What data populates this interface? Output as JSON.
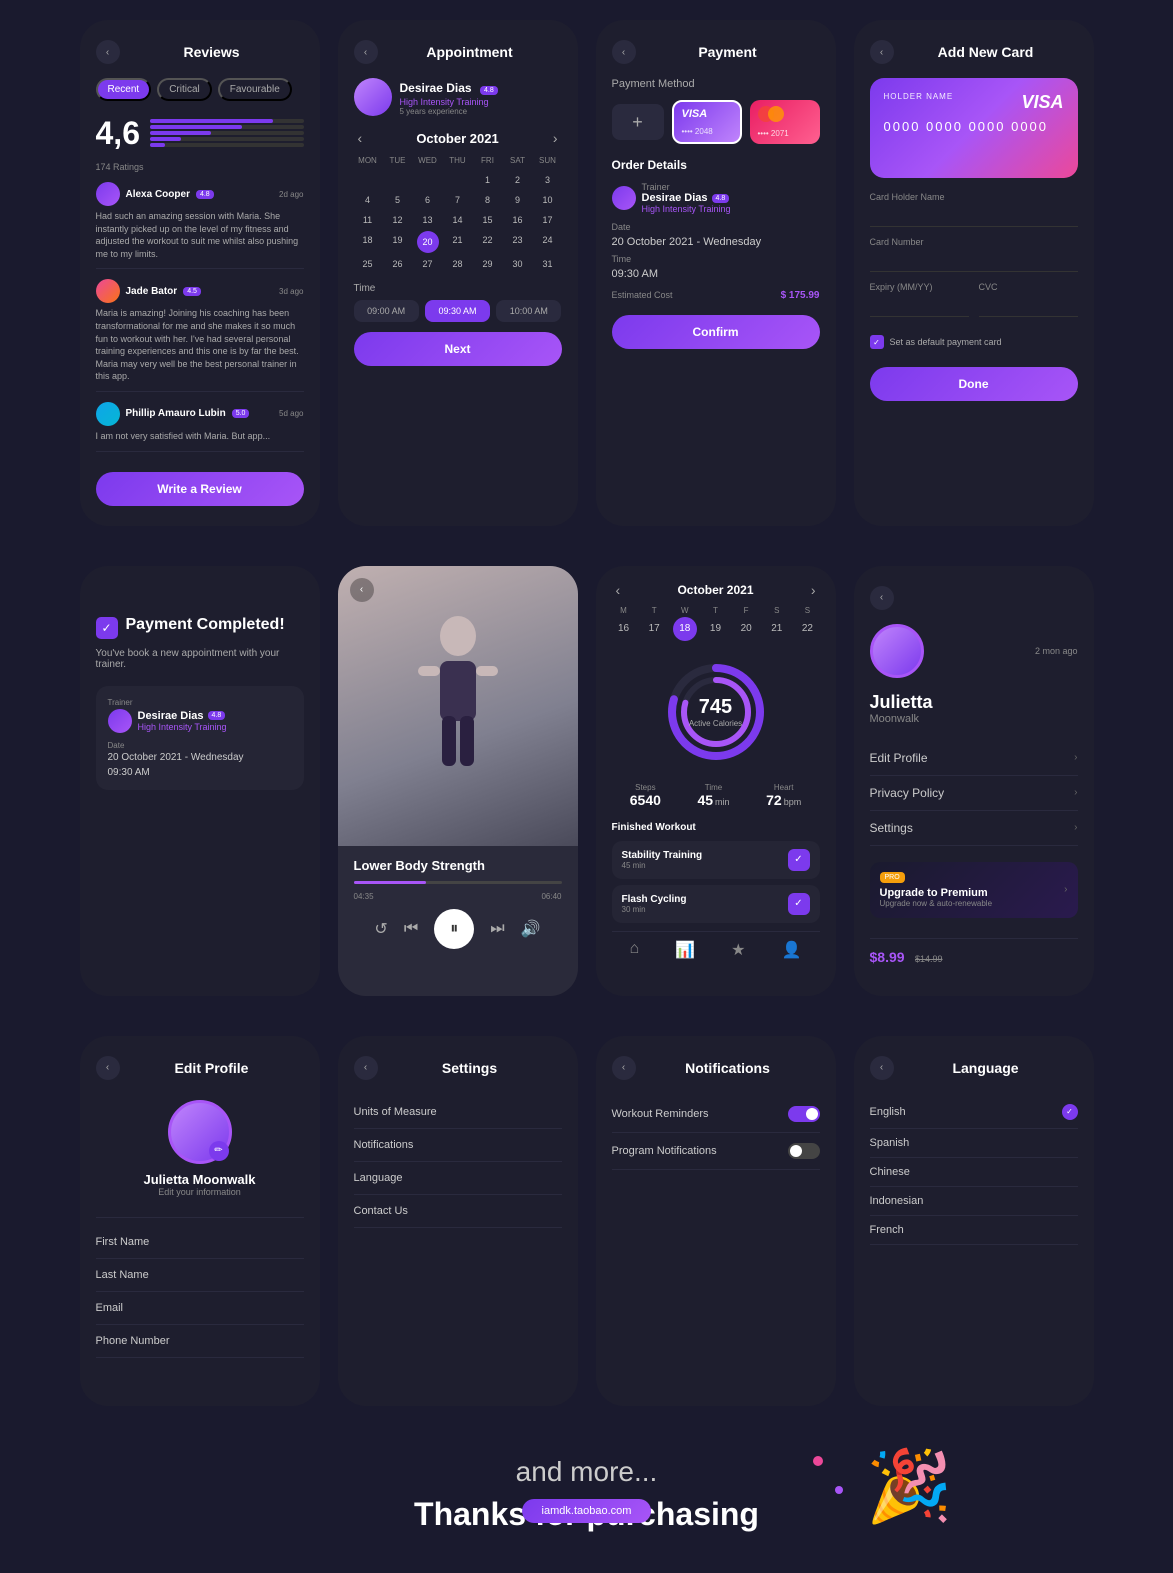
{
  "row1": {
    "reviews": {
      "title": "Reviews",
      "tabs": [
        "Recent",
        "Critical",
        "Favourable"
      ],
      "active_tab": "Recent",
      "rating": "4,6",
      "ratings_count": "174 Ratings",
      "reviewers": [
        {
          "name": "Alexa Cooper",
          "badge": "4.8",
          "time": "2d ago",
          "text": "Had such an amazing session with Maria. She instantly picked up on the level of my fitness and adjusted the workout to suit me whilst also pushing me to my limits."
        },
        {
          "name": "Jade Bator",
          "badge": "4.5",
          "time": "3d ago",
          "text": "Maria is amazing! Joining his coaching has been transformational for me and she makes it so much fun to workout with her. I've had several personal training experiences and this one is by far the best. Maria may very well be the best personal trainer in this app."
        },
        {
          "name": "Phillip Amauro Lubin",
          "badge": "5.0",
          "time": "5d ago",
          "text": "I am not very satisfied with Maria. But app..."
        }
      ],
      "write_review_btn": "Write a Review"
    },
    "appointment": {
      "title": "Appointment",
      "trainer_name": "Desirae Dias",
      "trainer_badge": "4.8",
      "trainer_type": "High Intensity Training",
      "trainer_exp": "5 years experience",
      "month": "October 2021",
      "days": [
        "MON",
        "TUE",
        "WED",
        "THU",
        "FRI",
        "SAT",
        "SUN"
      ],
      "weeks": [
        [
          "",
          "",
          "",
          "",
          "1",
          "2",
          "3"
        ],
        [
          "4",
          "5",
          "6",
          "7",
          "8",
          "9",
          "10"
        ],
        [
          "11",
          "12",
          "13",
          "14",
          "15",
          "16",
          "17"
        ],
        [
          "18",
          "19",
          "20",
          "21",
          "22",
          "23",
          "24"
        ],
        [
          "25",
          "26",
          "27",
          "28",
          "29",
          "30",
          "31"
        ]
      ],
      "selected_day": "20",
      "time_label": "Time",
      "times": [
        "09:00 AM",
        "09:30 AM",
        "10:00 AM"
      ],
      "active_time": "09:30 AM",
      "next_btn": "Next"
    },
    "payment": {
      "title": "Payment",
      "method_label": "Payment Method",
      "visa_dots": "•••• 2048",
      "mc_dots": "•••• 2071",
      "order_details": "Order Details",
      "trainer_label": "Trainer",
      "trainer_name": "Desirae Dias",
      "trainer_badge": "4.8",
      "trainer_type": "High Intensity Training",
      "date_label": "Date",
      "date_val": "20 October 2021 - Wednesday",
      "time_label": "Time",
      "time_val": "09:30 AM",
      "cost_label": "Estimated Cost",
      "cost_val": "$ 175.99",
      "confirm_btn": "Confirm"
    },
    "add_card": {
      "title": "Add New Card",
      "holder_name_label": "HOLDER NAME",
      "holder_name_val": "0000 0000 0000 0000",
      "card_number_label": "Card Number",
      "card_holder_label": "Card Holder Name",
      "expiry_label": "Expiry (MM/YY)",
      "cvc_label": "CVC",
      "default_label": "Set as default payment card",
      "done_btn": "Done"
    }
  },
  "row2": {
    "payment_complete": {
      "icon": "✓",
      "title": "Payment Completed!",
      "subtitle": "You've book a new appointment with your trainer.",
      "trainer_label": "Trainer",
      "trainer_name": "Desirae Dias",
      "trainer_badge": "4.8",
      "trainer_type": "High Intensity Training",
      "date_label": "Date",
      "date_val": "20 October 2021 - Wednesday",
      "time_val": "09:30 AM"
    },
    "music": {
      "title": "Lower Body Strength",
      "current_time": "04:35",
      "total_time": "06:40"
    },
    "activity": {
      "month": "October 2021",
      "week_days": [
        "M",
        "T",
        "W",
        "T",
        "F",
        "S",
        "S"
      ],
      "week_nums": [
        "16",
        "17",
        "18",
        "19",
        "20",
        "21",
        "22"
      ],
      "active_day": "18",
      "calories": "745",
      "calories_label": "Active Calories",
      "steps": "6540",
      "time_val": "45",
      "time_unit": "min",
      "heart": "72",
      "heart_unit": "bpm",
      "finished_label": "Finished Workout",
      "workouts": [
        {
          "name": "Stability Training",
          "sub": "45 min"
        },
        {
          "name": "Flash Cycling",
          "sub": "30 min"
        }
      ]
    },
    "profile": {
      "time_ago": "2 mon ago",
      "name": "Julietta",
      "handle": "Moonwalk",
      "menu_items": [
        "Edit Profile",
        "Privacy Policy",
        "Settings"
      ],
      "premium_badge": "PRO",
      "upgrade_title": "Upgrade to Premium",
      "upgrade_sub": "Upgrade now & auto-renewable"
    }
  },
  "row3": {
    "edit_profile": {
      "title": "Edit Profile",
      "name": "Julietta Moonwalk",
      "sub": "Edit your information"
    },
    "settings": {
      "title": "Settings",
      "items": [
        "Units of Measure",
        "Notifications",
        "Language",
        "Contact Us"
      ]
    },
    "notifications": {
      "title": "Notifications",
      "items": [
        {
          "label": "Workout Reminders",
          "on": true
        },
        {
          "label": "Program Notifications",
          "on": false
        }
      ]
    },
    "language": {
      "title": "Language",
      "items": [
        {
          "label": "English",
          "selected": true
        },
        {
          "label": "Spanish",
          "selected": false
        },
        {
          "label": "Chinese",
          "selected": false
        },
        {
          "label": "Indonesian",
          "selected": false
        },
        {
          "label": "French",
          "selected": false
        }
      ]
    }
  },
  "bottom": {
    "and_more": "and more...",
    "thanks": "Thanks for purchasing"
  },
  "watermark": "iamdk.taobao.com"
}
